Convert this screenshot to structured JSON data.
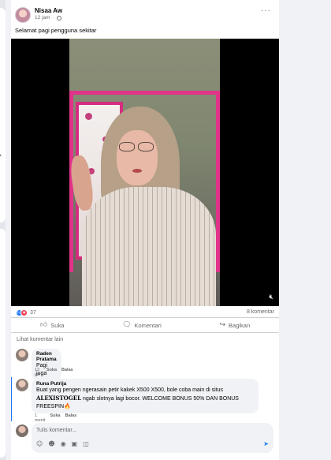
{
  "post": {
    "author": "Nisaa Aw",
    "time": "12 jam",
    "caption": "Selamat pagi pengguna sekitar",
    "more_icon": "more-horizontal-icon"
  },
  "stats": {
    "reaction_count": "37",
    "comments_count": "8 komentar"
  },
  "actions": {
    "like": "Suka",
    "comment": "Komentari",
    "share": "Bagikan"
  },
  "view_more_comments": "Lihat komentar lain",
  "comments": [
    {
      "name": "Raden Pratama",
      "text": "Pagi juga",
      "time": "12 jam",
      "like": "Suka",
      "reply": "Balas"
    },
    {
      "name": "Runa Putrija",
      "text_before": "Buat yang pengen ngerasain petir kakek X500 X500, bole coba main di situs",
      "brand": "ALEXISTOGEL",
      "text_after": "ngab slotnya lagi bocor. WELCOME BONUS 50% DAN BONUS FREESPIN",
      "emoji": "🔥",
      "time": "1 menit",
      "like": "Suka",
      "reply": "Balas"
    }
  ],
  "composer": {
    "placeholder": "Tulis komentar..."
  },
  "colors": {
    "accent": "#1877f2",
    "love": "#f33e58",
    "frame_pink": "#e0338a"
  }
}
